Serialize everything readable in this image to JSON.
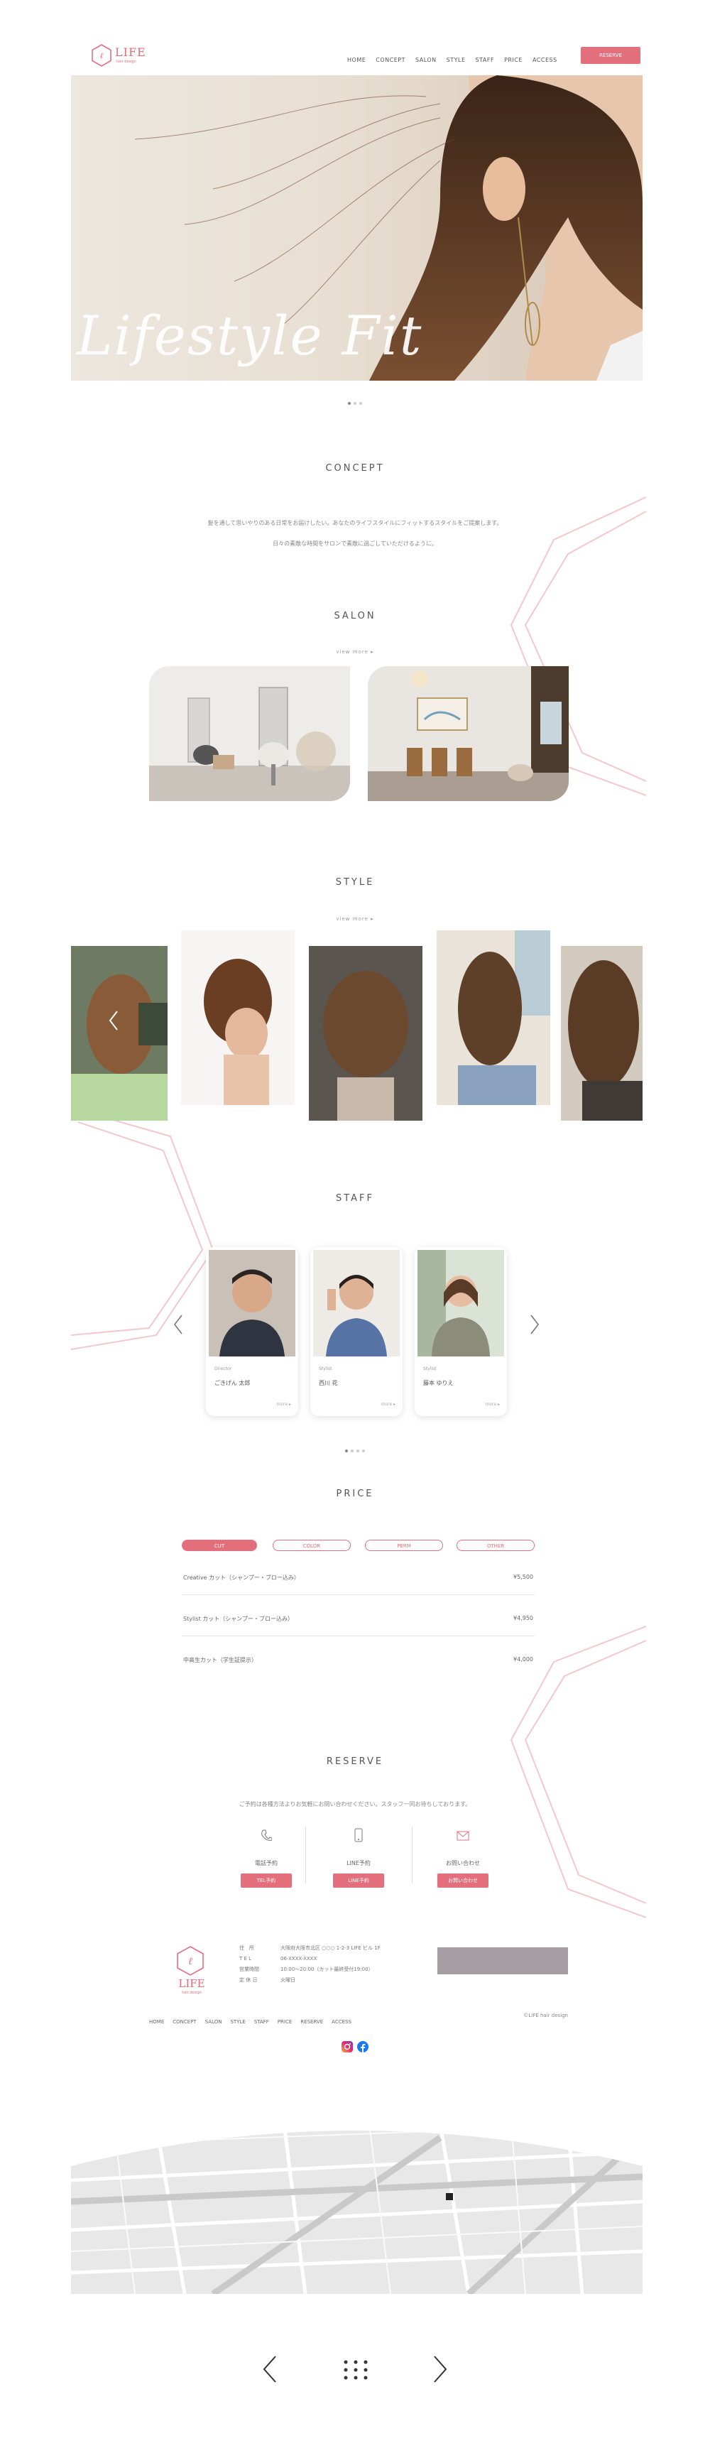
{
  "header": {
    "logo_text": "LIFE",
    "logo_sub": "hair design",
    "nav": [
      "HOME",
      "CONCEPT",
      "SALON",
      "STYLE",
      "STAFF",
      "PRICE",
      "ACCESS"
    ],
    "reserve_button": "RESERVE"
  },
  "hero": {
    "script_text": "Lifestyle Fit"
  },
  "concept": {
    "title": "CONCEPT",
    "line1": "髪を通して思いやりのある日常をお届けしたい。あなたのライフスタイルにフィットするスタイルをご提案します。",
    "line2": "日々の素敵な時間をサロンで素敵に過ごしていただけるように。"
  },
  "salon": {
    "title": "SALON",
    "more": "view more"
  },
  "style": {
    "title": "STYLE",
    "more": "view more"
  },
  "staff": {
    "title": "STAFF",
    "members": [
      {
        "role": "Director",
        "name": "ごきげん 太郎",
        "more": "more"
      },
      {
        "role": "Stylist",
        "name": "西川 花",
        "more": "more"
      },
      {
        "role": "Stylist",
        "name": "藤本 ゆりえ",
        "more": "more"
      }
    ]
  },
  "price": {
    "title": "PRICE",
    "tabs": [
      "CUT",
      "COLOR",
      "PERM",
      "OTHER"
    ],
    "rows": [
      {
        "name": "Creative カット（シャンプー・ブロー込み）",
        "price": "¥5,500"
      },
      {
        "name": "Stylist カット（シャンプー・ブロー込み）",
        "price": "¥4,950"
      },
      {
        "name": "中高生カット（学生証提示）",
        "price": "¥4,000"
      }
    ]
  },
  "reserve": {
    "title": "RESERVE",
    "intro": "ご予約は各種方法よりお気軽にお問い合わせください。スタッフ一同お待ちしております。",
    "options": [
      {
        "label": "電話予約",
        "button": "TEL予約"
      },
      {
        "label": "LINE予約",
        "button": "LINE予約"
      },
      {
        "label": "お問い合わせ",
        "button": "お問い合わせ"
      }
    ]
  },
  "footer": {
    "logo_text": "LIFE",
    "logo_sub": "hair design",
    "info": [
      {
        "k": "住　所",
        "v": "大阪府大阪市北区 ○○○ 1-2-3 LIFE ビル 1F"
      },
      {
        "k": "T E L",
        "v": "06-XXXX-XXXX"
      },
      {
        "k": "営業時間",
        "v": "10:00〜20:00（カット最終受付19:00）"
      },
      {
        "k": "定 休 日",
        "v": "火曜日"
      }
    ],
    "nav": [
      "HOME",
      "CONCEPT",
      "SALON",
      "STYLE",
      "STAFF",
      "PRICE",
      "RESERVE",
      "ACCESS"
    ],
    "copyright": "©LIFE hair design"
  },
  "colors": {
    "accent": "#e36f7c",
    "deco_pink": "#f3c7cd"
  },
  "icons": [
    "chevron-left-icon",
    "chevron-right-icon",
    "phone-icon",
    "mobile-icon",
    "mail-icon",
    "instagram-icon",
    "facebook-icon",
    "grid-icon"
  ]
}
